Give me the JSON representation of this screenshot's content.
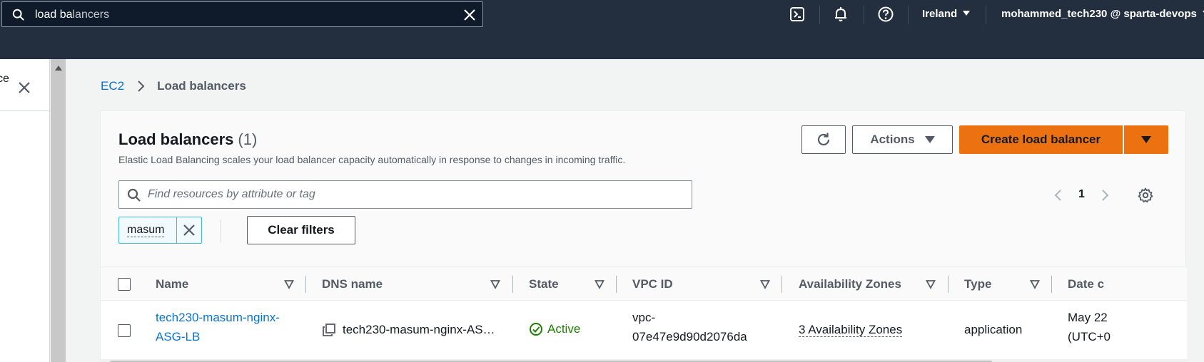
{
  "topnav": {
    "search_typed": "load ba",
    "search_autocomplete": "lancers",
    "region": "Ireland",
    "account": "mohammed_tech230 @ sparta-devops"
  },
  "left_panel": {
    "truncated_text": "ce"
  },
  "breadcrumb": {
    "root": "EC2",
    "current": "Load balancers"
  },
  "header": {
    "title": "Load balancers",
    "count": "(1)",
    "description": "Elastic Load Balancing scales your load balancer capacity automatically in response to changes in incoming traffic."
  },
  "toolbar": {
    "actions_label": "Actions",
    "create_label": "Create load balancer"
  },
  "filter": {
    "placeholder": "Find resources by attribute or tag",
    "value": "",
    "token": "masum",
    "clear_label": "Clear filters"
  },
  "pagination": {
    "current_page": "1"
  },
  "table": {
    "columns": [
      "Name",
      "DNS name",
      "State",
      "VPC ID",
      "Availability Zones",
      "Type",
      "Date c"
    ],
    "rows": [
      {
        "name_line1": "tech230-masum-nginx-",
        "name_line2": "ASG-LB",
        "dns": "tech230-masum-nginx-AS…",
        "state": "Active",
        "vpc_line1": "vpc-",
        "vpc_line2": "07e47e9d90d2076da",
        "azs": "3 Availability Zones",
        "type": "application",
        "date_line1": "May 22",
        "date_line2": "(UTC+0"
      }
    ]
  },
  "colors": {
    "nav_bg": "#232f3e",
    "primary": "#ec7211",
    "link": "#0972d3",
    "success": "#1d8102"
  }
}
